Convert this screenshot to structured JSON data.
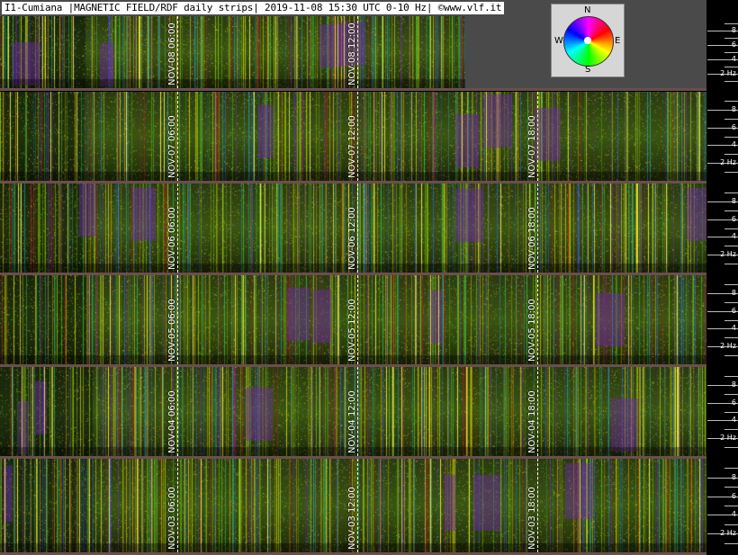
{
  "header": {
    "title": "I1-Cumiana |MAGNETIC FIELD/RDF daily strips| 2019-11-08 15:30 UTC 0-10 Hz| ©www.vlf.it"
  },
  "compass": {
    "icon": "compass-rose-icon",
    "north": "N",
    "south": "S",
    "east": "E",
    "west": "W"
  },
  "scale": {
    "ticks": [
      "8",
      "6",
      "4",
      "2 Hz"
    ]
  },
  "strips": [
    {
      "date": "NOV-08",
      "labels": [
        "NOV-08 06:00",
        "NOV-08 12:00"
      ],
      "partial": true
    },
    {
      "date": "NOV-07",
      "labels": [
        "NOV-07 06:00",
        "NOV-07 12:00",
        "NOV-07 18:00"
      ]
    },
    {
      "date": "NOV-06",
      "labels": [
        "NOV-06 06:00",
        "NOV-06 12:00",
        "NOV-06 18:00"
      ]
    },
    {
      "date": "NOV-05",
      "labels": [
        "NOV-05 06:00",
        "NOV-05 12:00",
        "NOV-05 18:00"
      ]
    },
    {
      "date": "NOV-04",
      "labels": [
        "NOV-04 06:00",
        "NOV-04 12:00",
        "NOV-04 18:00"
      ]
    },
    {
      "date": "NOV-03",
      "labels": [
        "NOV-03 06:00",
        "NOV-03 12:00",
        "NOV-03 18:00"
      ]
    }
  ],
  "colors": {
    "separator": "#6b4e4e",
    "header_bg": "#4a4a4a"
  }
}
